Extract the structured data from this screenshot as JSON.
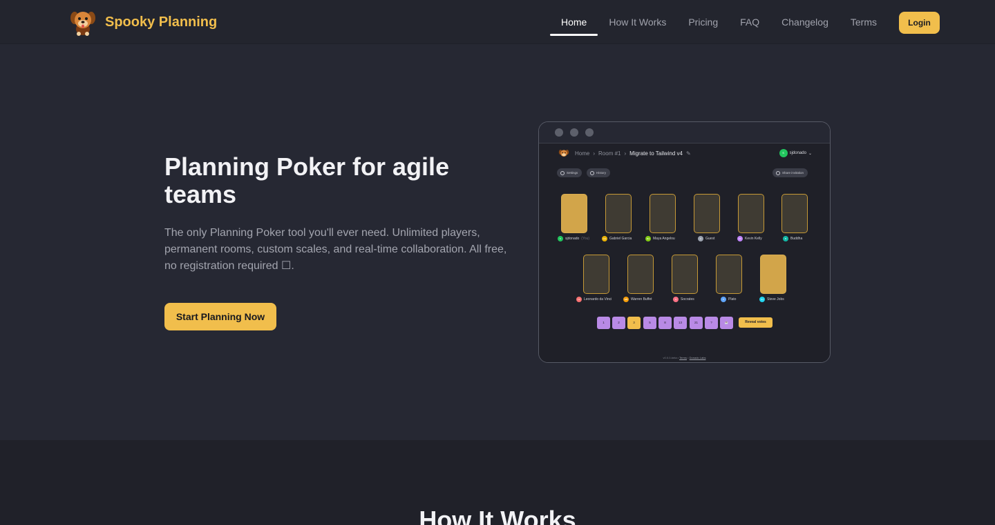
{
  "brand": {
    "name": "Spooky Planning",
    "logo_icon": "dog-icon",
    "color": "#f1be4c"
  },
  "nav": {
    "items": [
      {
        "label": "Home",
        "active": true
      },
      {
        "label": "How It Works",
        "active": false
      },
      {
        "label": "Pricing",
        "active": false
      },
      {
        "label": "FAQ",
        "active": false
      },
      {
        "label": "Changelog",
        "active": false
      },
      {
        "label": "Terms",
        "active": false
      }
    ],
    "login_label": "Login"
  },
  "hero": {
    "title": "Planning Poker for agile teams",
    "description": "The only Planning Poker tool you'll ever need. Unlimited players, permanent rooms, custom scales, and real-time collaboration. All free, no registration required ☐.",
    "cta_label": "Start Planning Now"
  },
  "mockup": {
    "breadcrumb": [
      "Home",
      "Room #1",
      "Migrate to Tailwind v4"
    ],
    "user": "sjdonado",
    "user_initial": "S",
    "settings_label": "Settings",
    "history_label": "History",
    "share_label": "Share invitation",
    "players": [
      {
        "name": "sjdonado",
        "host_tag": "(You)",
        "initial": "S",
        "color": "#22c55e",
        "voted": true
      },
      {
        "name": "Gabriel Garcia",
        "initial": "GG",
        "color": "#eab308",
        "voted": false
      },
      {
        "name": "Maya Angelou",
        "initial": "MA",
        "color": "#84cc16",
        "voted": false
      },
      {
        "name": "Guest",
        "initial": "G",
        "color": "#9ca3af",
        "voted": false
      },
      {
        "name": "Kevin Kelly",
        "initial": "KK",
        "color": "#c084fc",
        "voted": false
      },
      {
        "name": "Buddha",
        "initial": "B",
        "color": "#14b8a6",
        "voted": false
      },
      {
        "name": "Leonardo da Vinci",
        "initial": "LV",
        "color": "#f87171",
        "voted": false
      },
      {
        "name": "Warren Buffet",
        "initial": "WB",
        "color": "#f59e0b",
        "voted": false
      },
      {
        "name": "Socrates",
        "initial": "S",
        "color": "#fb7185",
        "voted": false
      },
      {
        "name": "Plato",
        "initial": "P",
        "color": "#60a5fa",
        "voted": false
      },
      {
        "name": "Steve Jobs",
        "initial": "SJ",
        "color": "#22d3ee",
        "voted": true
      }
    ],
    "votes": [
      "1",
      "2",
      "3",
      "5",
      "8",
      "13",
      "21",
      "?",
      "☕"
    ],
    "selected_vote": "3",
    "reveal_label": "Reveal votes",
    "footer_text": "v0.0.0-beta •",
    "footer_terms": "Terms",
    "footer_author": "Donado Labs"
  },
  "section2": {
    "title": "How It Works"
  }
}
